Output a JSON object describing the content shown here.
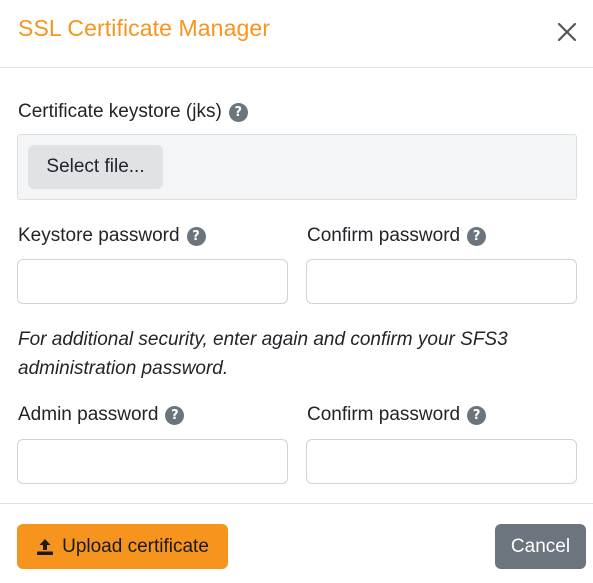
{
  "dialog": {
    "title": "SSL Certificate Manager",
    "close_icon": "close-icon"
  },
  "keystore": {
    "label": "Certificate keystore (jks)",
    "help_glyph": "?",
    "select_file_label": "Select file..."
  },
  "keystore_password": {
    "label": "Keystore password",
    "help_glyph": "?",
    "value": ""
  },
  "keystore_confirm": {
    "label": "Confirm password",
    "help_glyph": "?",
    "value": ""
  },
  "note": "For additional security, enter again and confirm your SFS3 administration password.",
  "admin_password": {
    "label": "Admin password",
    "help_glyph": "?",
    "value": ""
  },
  "admin_confirm": {
    "label": "Confirm password",
    "help_glyph": "?",
    "value": ""
  },
  "footer": {
    "upload_label": "Upload certificate",
    "upload_icon": "upload-icon",
    "cancel_label": "Cancel"
  },
  "colors": {
    "accent": "#f7941d",
    "secondary": "#6c757d"
  }
}
